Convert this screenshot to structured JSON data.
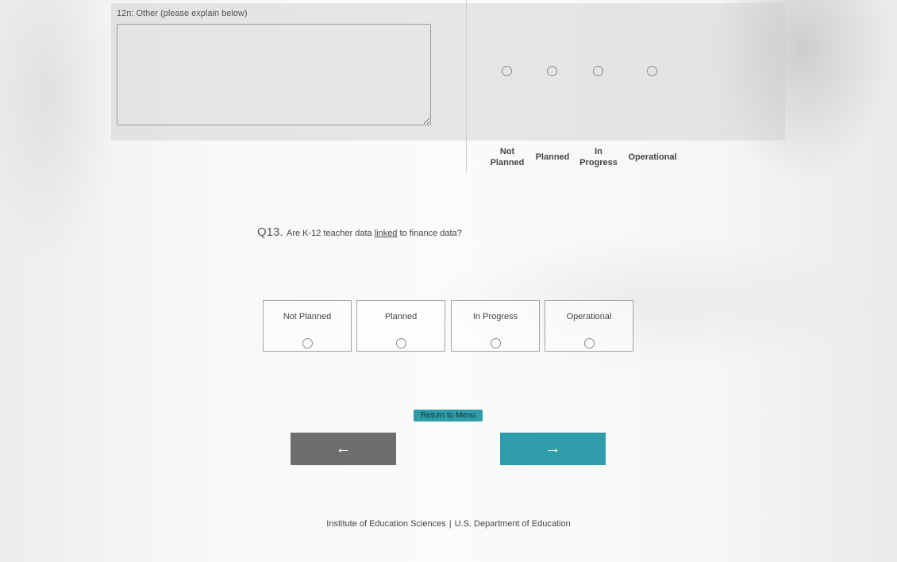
{
  "row12n": {
    "label": "12n: Other (please explain below)",
    "textarea_value": ""
  },
  "matrix_columns": [
    {
      "label_line1": "Not",
      "label_line2": "Planned"
    },
    {
      "label_line1": "Planned",
      "label_line2": ""
    },
    {
      "label_line1": "In",
      "label_line2": "Progress"
    },
    {
      "label_line1": "Operational",
      "label_line2": ""
    }
  ],
  "q13": {
    "number": "Q13.",
    "text_before": "Are K-12 teacher data ",
    "link_text": "linked",
    "text_after": " to finance data?",
    "options": [
      "Not Planned",
      "Planned",
      "In Progress",
      "Operational"
    ]
  },
  "nav": {
    "return_label": "Return to Menu",
    "back_label": "←",
    "next_label": "→"
  },
  "footer": {
    "org1": "Institute of Education Sciences",
    "separator": "|",
    "org2": "U.S. Department of Education"
  },
  "colors": {
    "accent": "#2e9ca9",
    "back_button": "#6e6e6e"
  }
}
